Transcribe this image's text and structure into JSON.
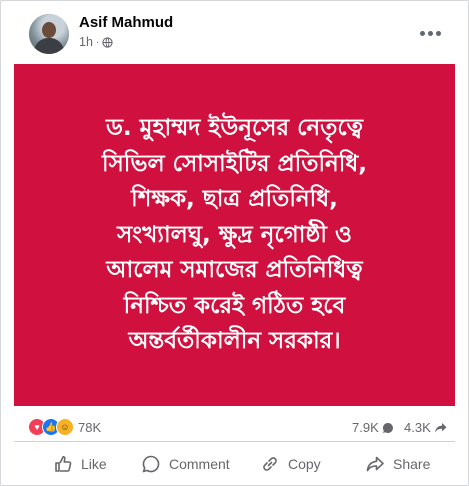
{
  "post": {
    "author": "Asif Mahmud",
    "time": "1h",
    "separator": "·",
    "hero_text": "ড. মুহাম্মদ ইউনূসের নেতৃত্বে\nসিভিল সোসাইটির প্রতিনিধি,\nশিক্ষক, ছাত্র প্রতিনিধি,\nসংখ্যালঘু, ক্ষুদ্র নৃগোষ্ঠী ও\nআলেম সমাজের প্রতিনিধিত্ব\nনিশ্চিত করেই গঠিত হবে\nঅন্তর্বর্তীকালীন সরকার।",
    "hero_color": "#d0103f"
  },
  "stats": {
    "reactions": "78K",
    "comments": "7.9K",
    "shares": "4.3K"
  },
  "actions": {
    "like": "Like",
    "comment": "Comment",
    "copy": "Copy",
    "share": "Share"
  }
}
